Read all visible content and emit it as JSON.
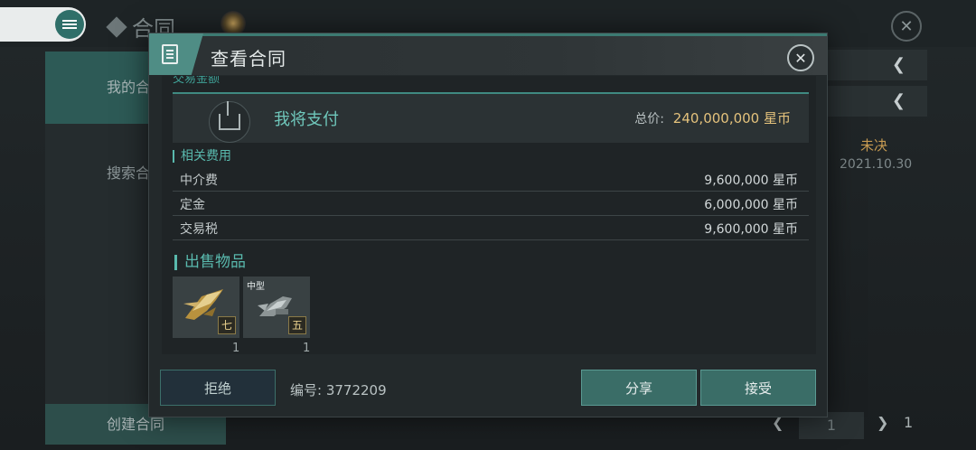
{
  "background": {
    "title": "合同",
    "sidebar_my": "我的合",
    "sidebar_search": "搜索合",
    "create_button": "创建合同",
    "status": "未决",
    "date": "2021.10.30",
    "pager_current": "1",
    "pager_total": "1"
  },
  "modal": {
    "title": "查看合同",
    "cut_section": "交易金额",
    "pay": {
      "label": "我将支付",
      "total_label": "总价:",
      "total_value": "240,000,000 星币"
    },
    "fees_section": "相关费用",
    "fees": [
      {
        "name": "中介费",
        "value": "9,600,000 星币"
      },
      {
        "name": "定金",
        "value": "6,000,000 星币"
      },
      {
        "name": "交易税",
        "value": "9,600,000 星币"
      }
    ],
    "items_section": "出售物品",
    "items": [
      {
        "tag": "七",
        "qty": "1",
        "size": ""
      },
      {
        "tag": "五",
        "qty": "1",
        "size": "中型"
      }
    ],
    "reject_button": "拒绝",
    "contract_number": "编号: 3772209",
    "share_button": "分享",
    "accept_button": "接受"
  },
  "colors": {
    "accent": "#3a6d67",
    "highlight_text": "#59b9ad",
    "price_gold": "#e4c27c",
    "status_orange": "#c79b52"
  },
  "icons": [
    "menu-icon",
    "cube-icon",
    "close-icon",
    "document-icon",
    "payment-upload-icon",
    "chevron-left-icon",
    "chevron-right-icon",
    "ship-icon"
  ]
}
